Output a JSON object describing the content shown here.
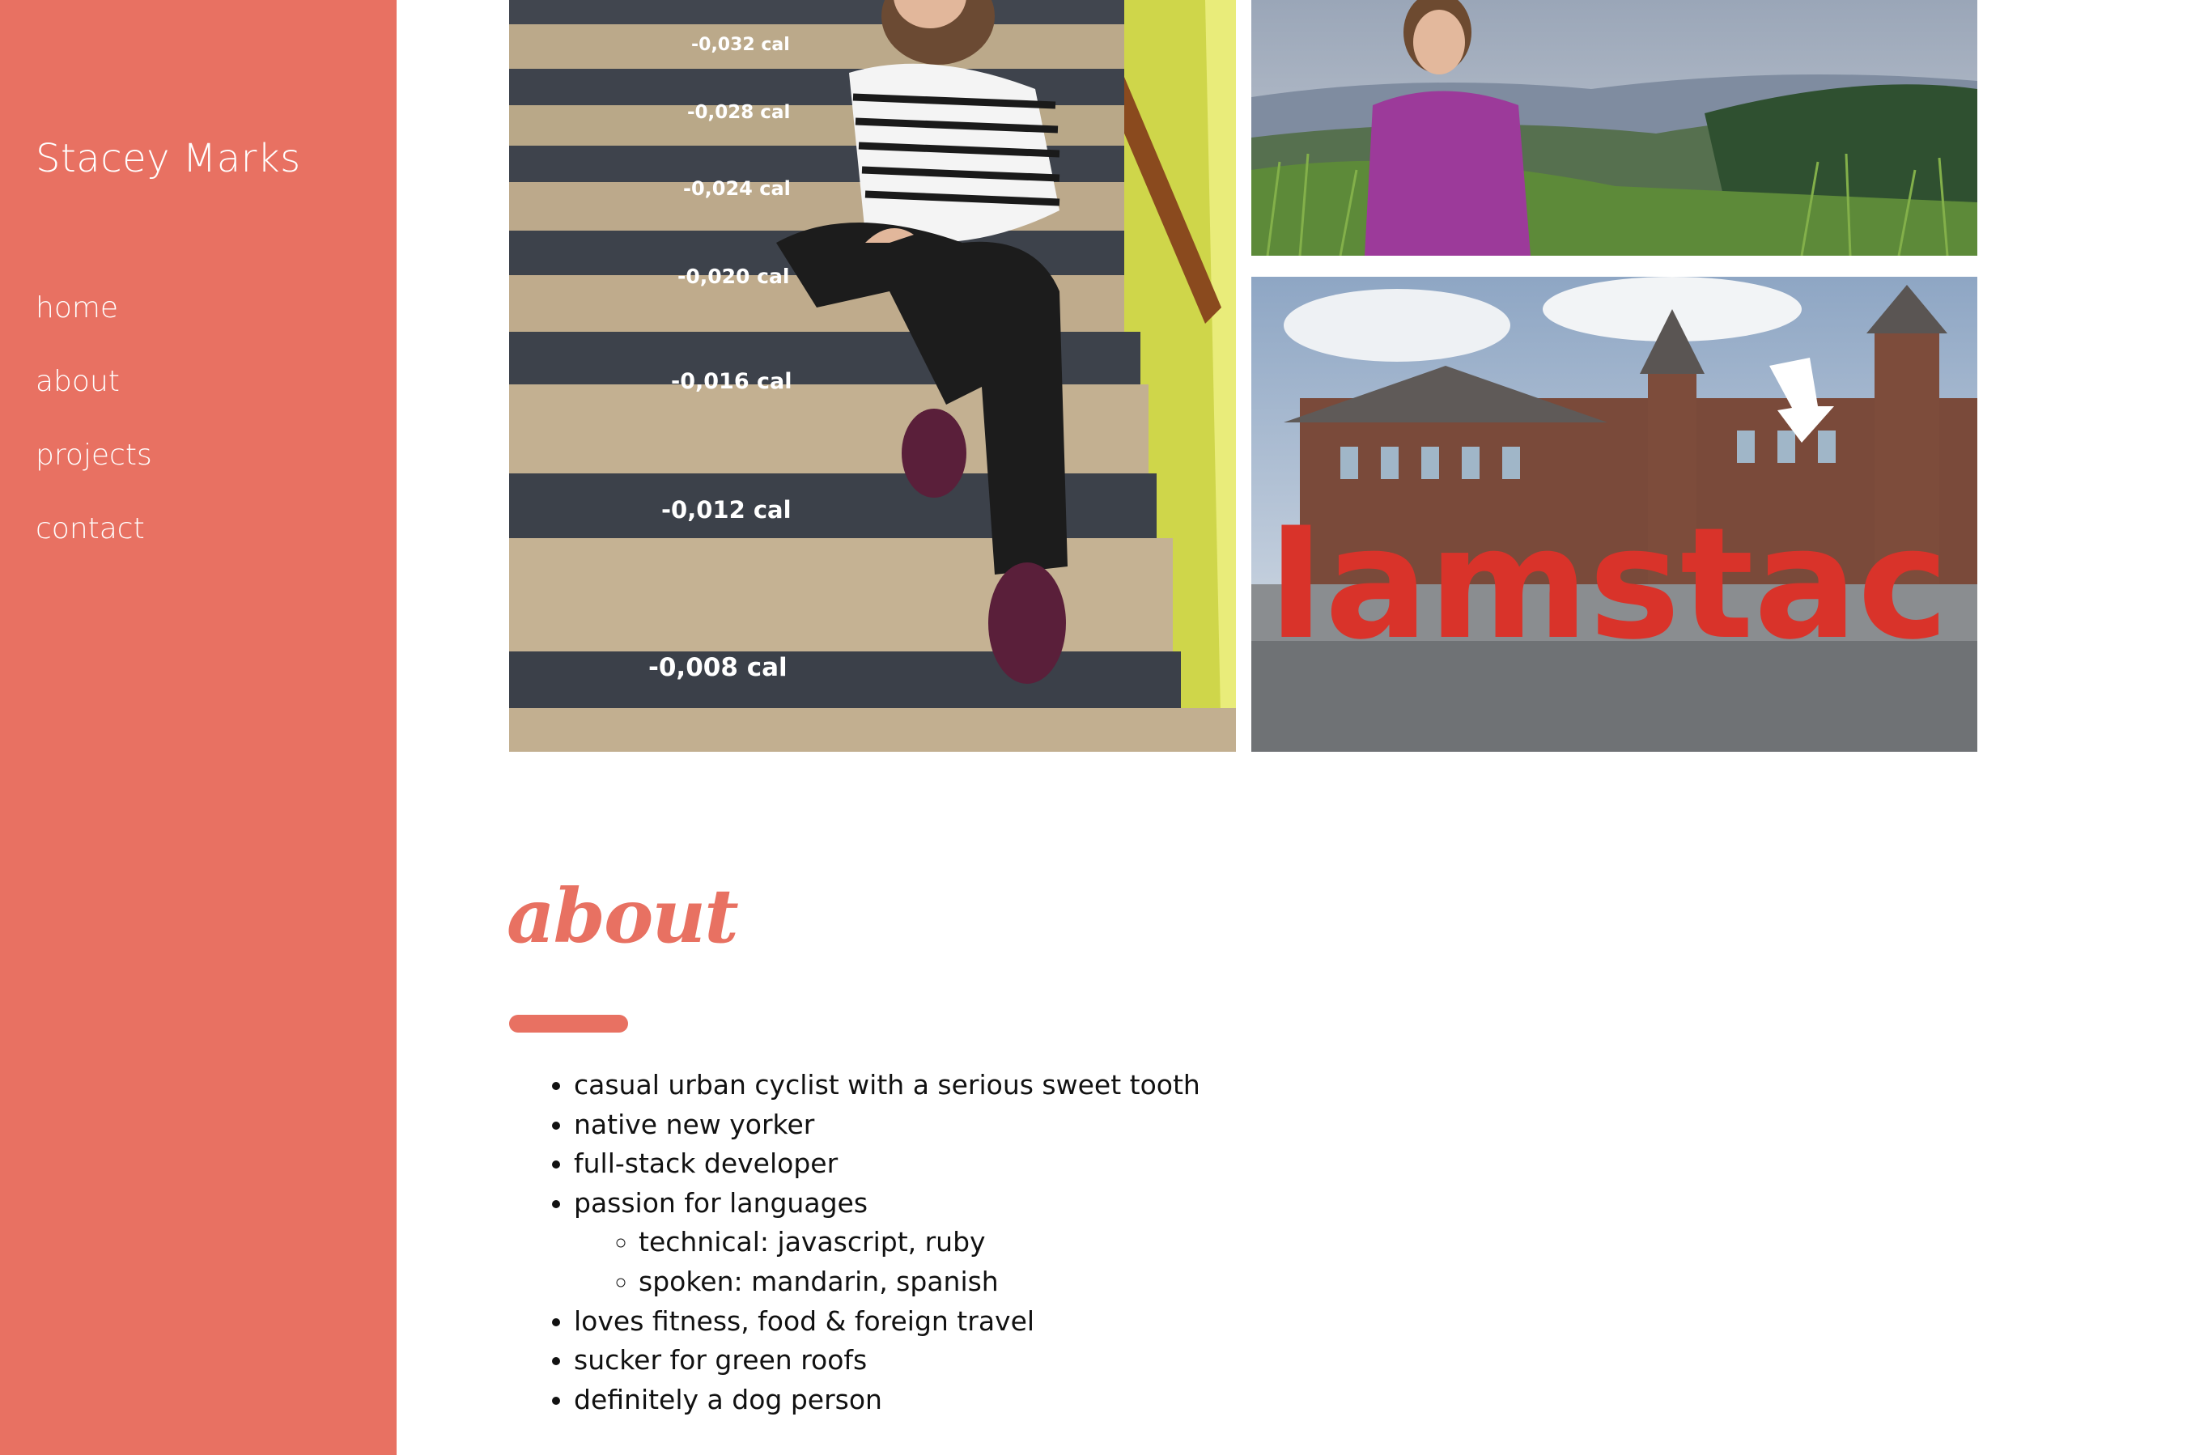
{
  "site": {
    "title": "Stacey Marks"
  },
  "nav": {
    "items": [
      {
        "label": "home"
      },
      {
        "label": "about"
      },
      {
        "label": "projects"
      },
      {
        "label": "contact"
      }
    ]
  },
  "photos": {
    "stairs": {
      "step_labels": [
        "-0,032 cal",
        "-0,028 cal",
        "-0,024 cal",
        "-0,020 cal",
        "-0,016 cal",
        "-0,012 cal",
        "-0,008 cal"
      ]
    },
    "amsterdam": {
      "sign_text": "Iamstac"
    }
  },
  "about": {
    "heading": "about",
    "items": [
      "casual urban cyclist with a serious sweet tooth",
      "native new yorker",
      "full-stack developer",
      "passion for languages"
    ],
    "sub_items": [
      "technical: javascript, ruby",
      "spoken: mandarin, spanish"
    ],
    "items_after": [
      "loves fitness, food & foreign travel",
      "sucker for green roofs",
      "definitely a dog person"
    ]
  },
  "colors": {
    "accent": "#e87162",
    "text": "#111111",
    "background": "#ffffff"
  }
}
